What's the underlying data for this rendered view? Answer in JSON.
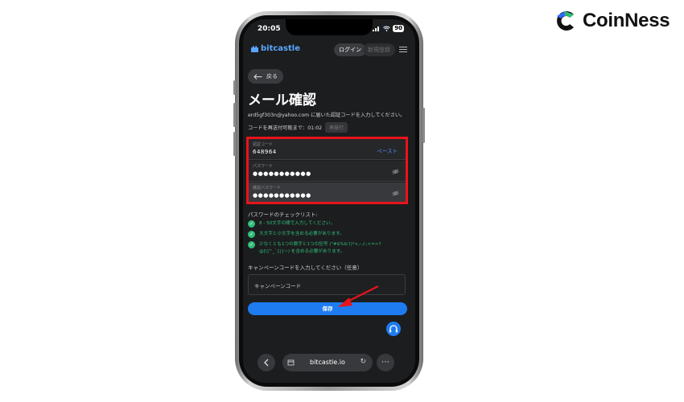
{
  "branding": {
    "name": "CoinNess"
  },
  "status_bar": {
    "time": "20:05",
    "battery": "90"
  },
  "app_bar": {
    "brand": "bitcastle",
    "login": "ログイン",
    "signup": "新規登録"
  },
  "page": {
    "back": "戻る",
    "title": "メール確認",
    "email_notice": "erd5gf303n@yahoo.com に届いた認証コードを入力してください。",
    "resend_text": "コードを再送付可能まで：01:02",
    "resend_button": "再発行"
  },
  "form": {
    "code": {
      "label": "認証コード",
      "value": "648964",
      "paste": "ペースト"
    },
    "password": {
      "label": "パスワード",
      "value": "●●●●●●●●●●●"
    },
    "confirm_password": {
      "label": "確認パスワード",
      "value": "●●●●●●●●●●●"
    }
  },
  "checklist": {
    "title": "パスワードのチェックリスト:",
    "items": [
      "8 - 50文字の間で入力してください。",
      "大文字と小文字を含める必要があります。",
      "少なくとも1つの数字と1つの記号 (\"#$%&'()*+,-./:;<=>?@[\\]^_`{|}~) を含める必要があります。"
    ]
  },
  "campaign": {
    "label": "キャンペーンコードを入力してください（任意）",
    "placeholder": "キャンペーンコード"
  },
  "save_button": "保存",
  "browser": {
    "url": "bitcastle.io"
  },
  "colors": {
    "accent": "#1e7bf0",
    "check": "#2fbd78",
    "highlight": "#e8141b",
    "screen_bg": "#1c1d1f"
  }
}
